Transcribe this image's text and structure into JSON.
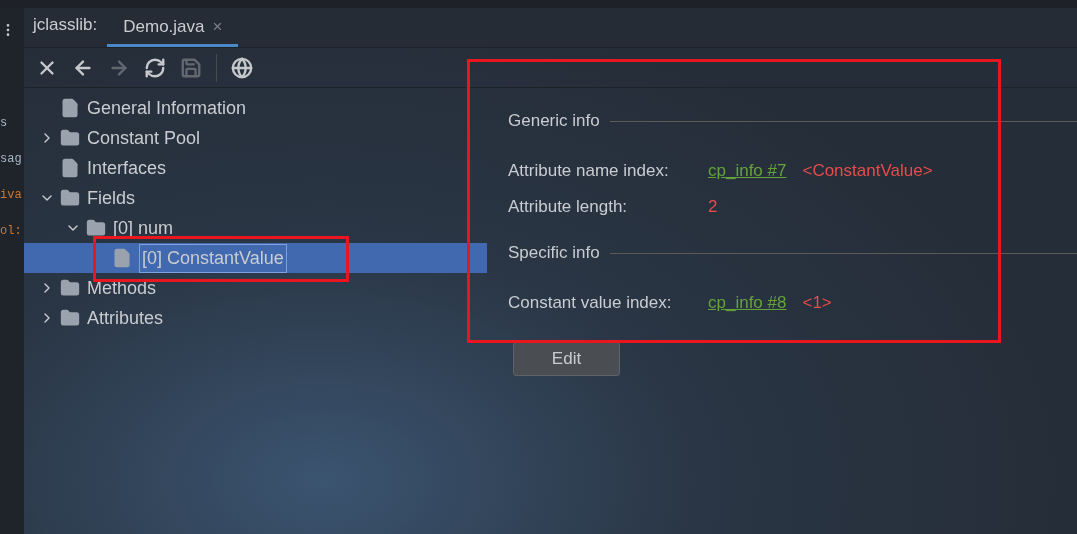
{
  "tool_window": {
    "title": "jclasslib:",
    "tabs": [
      {
        "label": "Demo.java",
        "selected": true,
        "close": "×"
      }
    ]
  },
  "editor_fragments": [
    {
      "text": "s",
      "color": "#a9b7c6"
    },
    {
      "text": "sag",
      "color": "#a9b7c6"
    },
    {
      "text": "iva",
      "color": "#cc7832"
    },
    {
      "text": "ol:",
      "color": "#cc7832"
    }
  ],
  "toolbar": [
    {
      "kind": "close",
      "disabled": false
    },
    {
      "kind": "back",
      "disabled": false
    },
    {
      "kind": "forward",
      "disabled": true
    },
    {
      "kind": "refresh",
      "disabled": false
    },
    {
      "kind": "save",
      "disabled": true
    },
    {
      "kind": "web",
      "disabled": false
    }
  ],
  "tree": [
    {
      "label": "General Information",
      "kind": "file",
      "selected": false
    },
    {
      "label": "Constant Pool",
      "kind": "folder",
      "expanded": false,
      "selected": false
    },
    {
      "label": "Interfaces",
      "kind": "file",
      "selected": false
    },
    {
      "label": "Fields",
      "kind": "folder",
      "expanded": true,
      "selected": false,
      "children": [
        {
          "label": "[0] num",
          "kind": "folder",
          "expanded": true,
          "selected": false,
          "children": [
            {
              "label": "[0] ConstantValue",
              "kind": "file",
              "selected": true
            }
          ]
        }
      ]
    },
    {
      "label": "Methods",
      "kind": "folder",
      "expanded": false,
      "selected": false
    },
    {
      "label": "Attributes",
      "kind": "folder",
      "expanded": false,
      "selected": false
    }
  ],
  "details": {
    "sections": [
      {
        "title": "Generic info",
        "rows": [
          {
            "label": "Attribute name index:",
            "link": "cp_info #7",
            "value": "<ConstantValue>"
          },
          {
            "label": "Attribute length:",
            "value": "2"
          }
        ]
      },
      {
        "title": "Specific info",
        "rows": [
          {
            "label": "Constant value index:",
            "link": "cp_info #8",
            "value": "<1>"
          }
        ]
      }
    ],
    "button": "Edit"
  }
}
